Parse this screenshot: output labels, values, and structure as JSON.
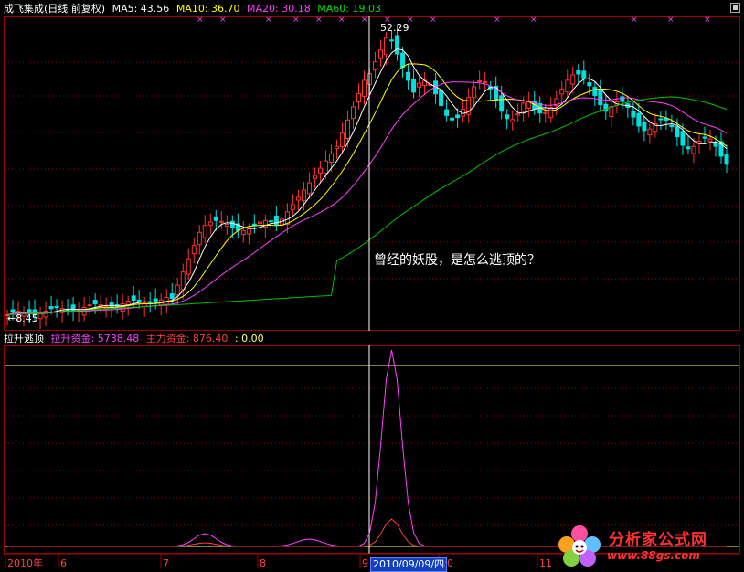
{
  "main_header": {
    "stock": "成飞集成(日线 前复权)",
    "ma5": "MA5: 43.56",
    "ma10": "MA10: 36.70",
    "ma20": "MA20: 30.18",
    "ma60": "MA60: 19.03"
  },
  "sub_header": {
    "indicator": "拉升逃顶",
    "lift": "拉升资金: 5738.48",
    "main": "主力资金: 876.40",
    "third": ": 0.00"
  },
  "annotation": "曾经的妖股，是怎么逃顶的？",
  "price_high_label": "52.29",
  "price_low_label": "←8.45",
  "cursor_date": "2010/09/09/四",
  "logo": {
    "title": "分析家公式网",
    "url": "www.88gs.com"
  },
  "colors": {
    "up": "#ff3232",
    "down": "#00e0e0",
    "ma5": "#ffffff",
    "ma10": "#ffff00",
    "ma20": "#ff40ff",
    "ma60": "#00c000",
    "grid": "#a00000",
    "lift": "#ff40ff",
    "main": "#ff4040",
    "hline": "#ffff80"
  },
  "chart_data": [
    {
      "type": "candlestick",
      "title": "成飞集成(日线 前复权)",
      "series": [
        {
          "name": "MA5",
          "value": 43.56
        },
        {
          "name": "MA10",
          "value": 36.7
        },
        {
          "name": "MA20",
          "value": 30.18
        },
        {
          "name": "MA60",
          "value": 19.03
        }
      ],
      "x_labels": [
        "2010年",
        "6",
        "7",
        "8",
        "9",
        "10",
        "11"
      ],
      "annotations": [
        "52.29",
        "←8.45"
      ],
      "high": 52.29,
      "low": 8.45
    },
    {
      "type": "line",
      "title": "拉升逃顶",
      "series": [
        {
          "name": "拉升资金",
          "last": 5738.48
        },
        {
          "name": "主力资金",
          "last": 876.4
        }
      ]
    }
  ]
}
